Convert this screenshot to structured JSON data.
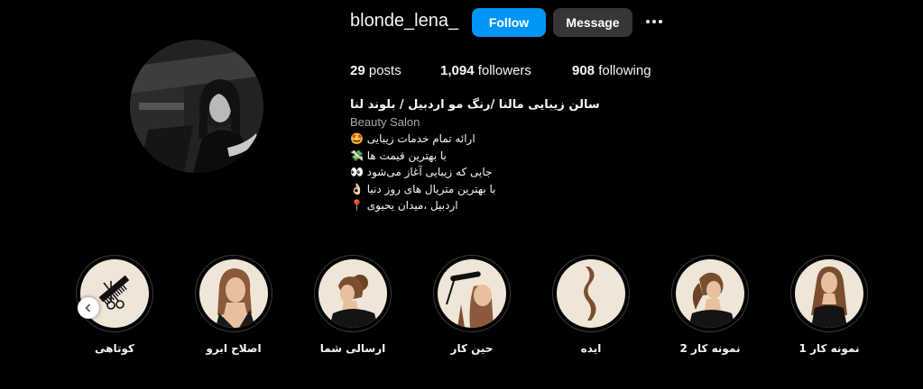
{
  "profile": {
    "username": "blonde_lena_",
    "follow_label": "Follow",
    "message_label": "Message",
    "more_icon": "more-horizontal-icon",
    "stats": {
      "posts_count": "29",
      "posts_label": "posts",
      "followers_count": "1,094",
      "followers_label": "followers",
      "following_count": "908",
      "following_label": "following"
    },
    "bio": {
      "name": "سالن زیبایی مالنا /رنگ مو اردبیل / بلوند لنا",
      "category": "Beauty Salon",
      "lines": [
        "ارائه تمام خدمات زیبایی 🤩",
        "با بهترین قیمت ها 💸",
        "جایی که زیبایی آغاز می‌شود 👀",
        "با بهترین متریال های روز دنیا 👌🏻",
        "اردبیل ،میدان یحیوی 📍"
      ]
    }
  },
  "highlights": [
    {
      "label": "کوتاهی",
      "icon": "scissors-comb-icon"
    },
    {
      "label": "اصلاح ابرو",
      "icon": "woman-portrait-icon"
    },
    {
      "label": "ارسالی شما",
      "icon": "woman-bun-icon"
    },
    {
      "label": "حین کار",
      "icon": "hair-straightener-icon"
    },
    {
      "label": "ایده",
      "icon": "hair-wave-icon"
    },
    {
      "label": "نمونه کار 2",
      "icon": "woman-ponytail-icon"
    },
    {
      "label": "نمونه کار 1",
      "icon": "woman-long-hair-icon"
    }
  ],
  "colors": {
    "background": "#000000",
    "follow_button": "#0095f6",
    "message_button": "#363636",
    "highlight_bg": "#efe6d8"
  }
}
